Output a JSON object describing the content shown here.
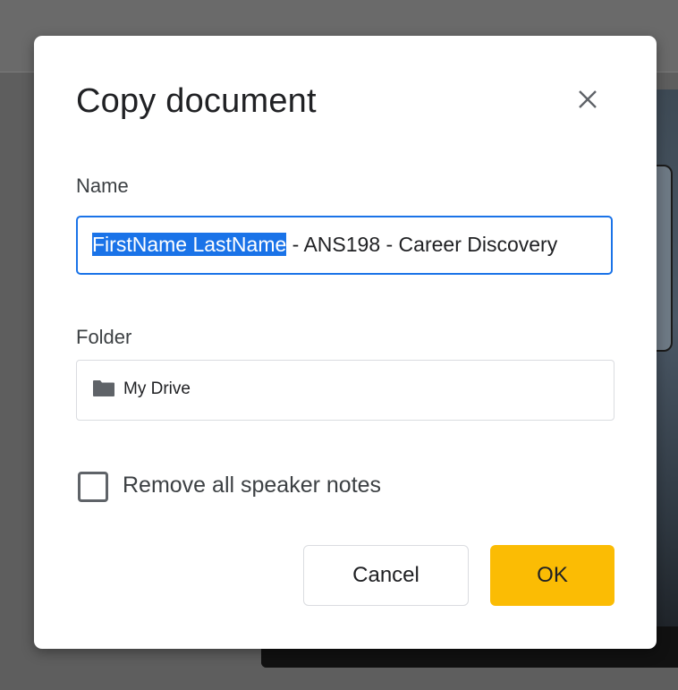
{
  "dialog": {
    "title": "Copy document",
    "close_icon": "close-icon",
    "name_label": "Name",
    "name_value_selected": "FirstName LastName",
    "name_value_rest": " - ANS198 - Career Discovery",
    "folder_label": "Folder",
    "folder_icon": "folder-icon",
    "folder_value": "My Drive",
    "checkbox_label": "Remove all speaker notes",
    "checkbox_checked": false,
    "cancel_label": "Cancel",
    "ok_label": "OK"
  },
  "colors": {
    "accent": "#1a73e8",
    "ok_button": "#fbbc04",
    "overlay": "#5f5f5f"
  }
}
